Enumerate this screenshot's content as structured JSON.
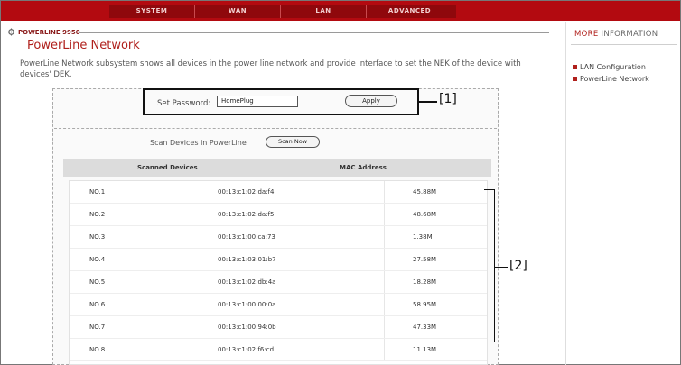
{
  "nav": {
    "tabs": [
      "SYSTEM",
      "WAN",
      "LAN",
      "ADVANCED"
    ]
  },
  "breadcrumb": "POWERLINE 9950",
  "page": {
    "title": "PowerLine Network",
    "description": "PowerLine Network subsystem shows all devices in the power line network and provide interface to set the NEK of the device with devices' DEK."
  },
  "password": {
    "label": "Set Password:",
    "value": "HomePlug",
    "apply_label": "Apply"
  },
  "scan": {
    "label": "Scan Devices in PowerLine",
    "button_label": "Scan Now"
  },
  "table": {
    "headers": [
      "Scanned Devices",
      "MAC Address"
    ],
    "rows": [
      {
        "no": "NO.1",
        "mac": "00:13:c1:02:da:f4",
        "rate": "45.88M"
      },
      {
        "no": "NO.2",
        "mac": "00:13:c1:02:da:f5",
        "rate": "48.68M"
      },
      {
        "no": "NO.3",
        "mac": "00:13:c1:00:ca:73",
        "rate": "1.38M"
      },
      {
        "no": "NO.4",
        "mac": "00:13:c1:03:01:b7",
        "rate": "27.58M"
      },
      {
        "no": "NO.5",
        "mac": "00:13:c1:02:db:4a",
        "rate": "18.28M"
      },
      {
        "no": "NO.6",
        "mac": "00:13:c1:00:00:0a",
        "rate": "58.95M"
      },
      {
        "no": "NO.7",
        "mac": "00:13:c1:00:94:0b",
        "rate": "47.33M"
      },
      {
        "no": "NO.8",
        "mac": "00:13:c1:02:f6:cd",
        "rate": "11.13M"
      }
    ]
  },
  "callouts": {
    "one": "[1]",
    "two": "[2]"
  },
  "more_info": {
    "title_prefix": "MORE",
    "title_rest": "INFORMATION",
    "links": [
      "LAN Configuration",
      "PowerLine Network"
    ]
  },
  "colors": {
    "nav_bg": "#b30a10",
    "accent": "#b0201c"
  }
}
